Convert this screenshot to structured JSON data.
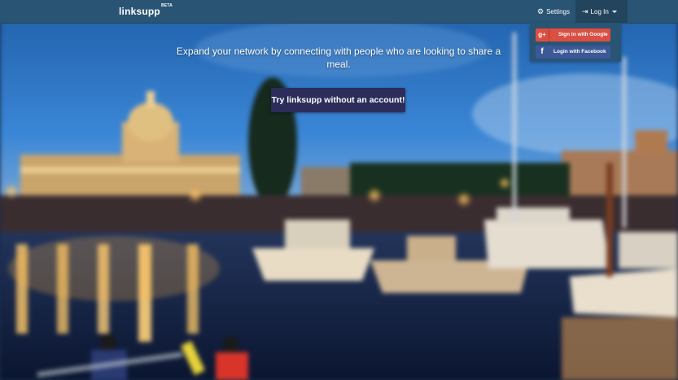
{
  "navbar": {
    "brand_main": "linksupp",
    "brand_badge": "BETA",
    "settings_label": "Settings",
    "login_label": "Log In"
  },
  "login_dropdown": {
    "google_label": "Sign in with Google",
    "google_icon_text": "g+",
    "facebook_label": "Login with Facebook",
    "facebook_icon_text": "f"
  },
  "hero": {
    "tagline": "Expand your network by connecting with people who are looking to share a meal.",
    "cta_label": "Try linksupp without an account!"
  },
  "colors": {
    "navbar": "#2a5474",
    "google": "#dc4e41",
    "facebook": "#3b5998",
    "cta": "#2c2d5a"
  }
}
